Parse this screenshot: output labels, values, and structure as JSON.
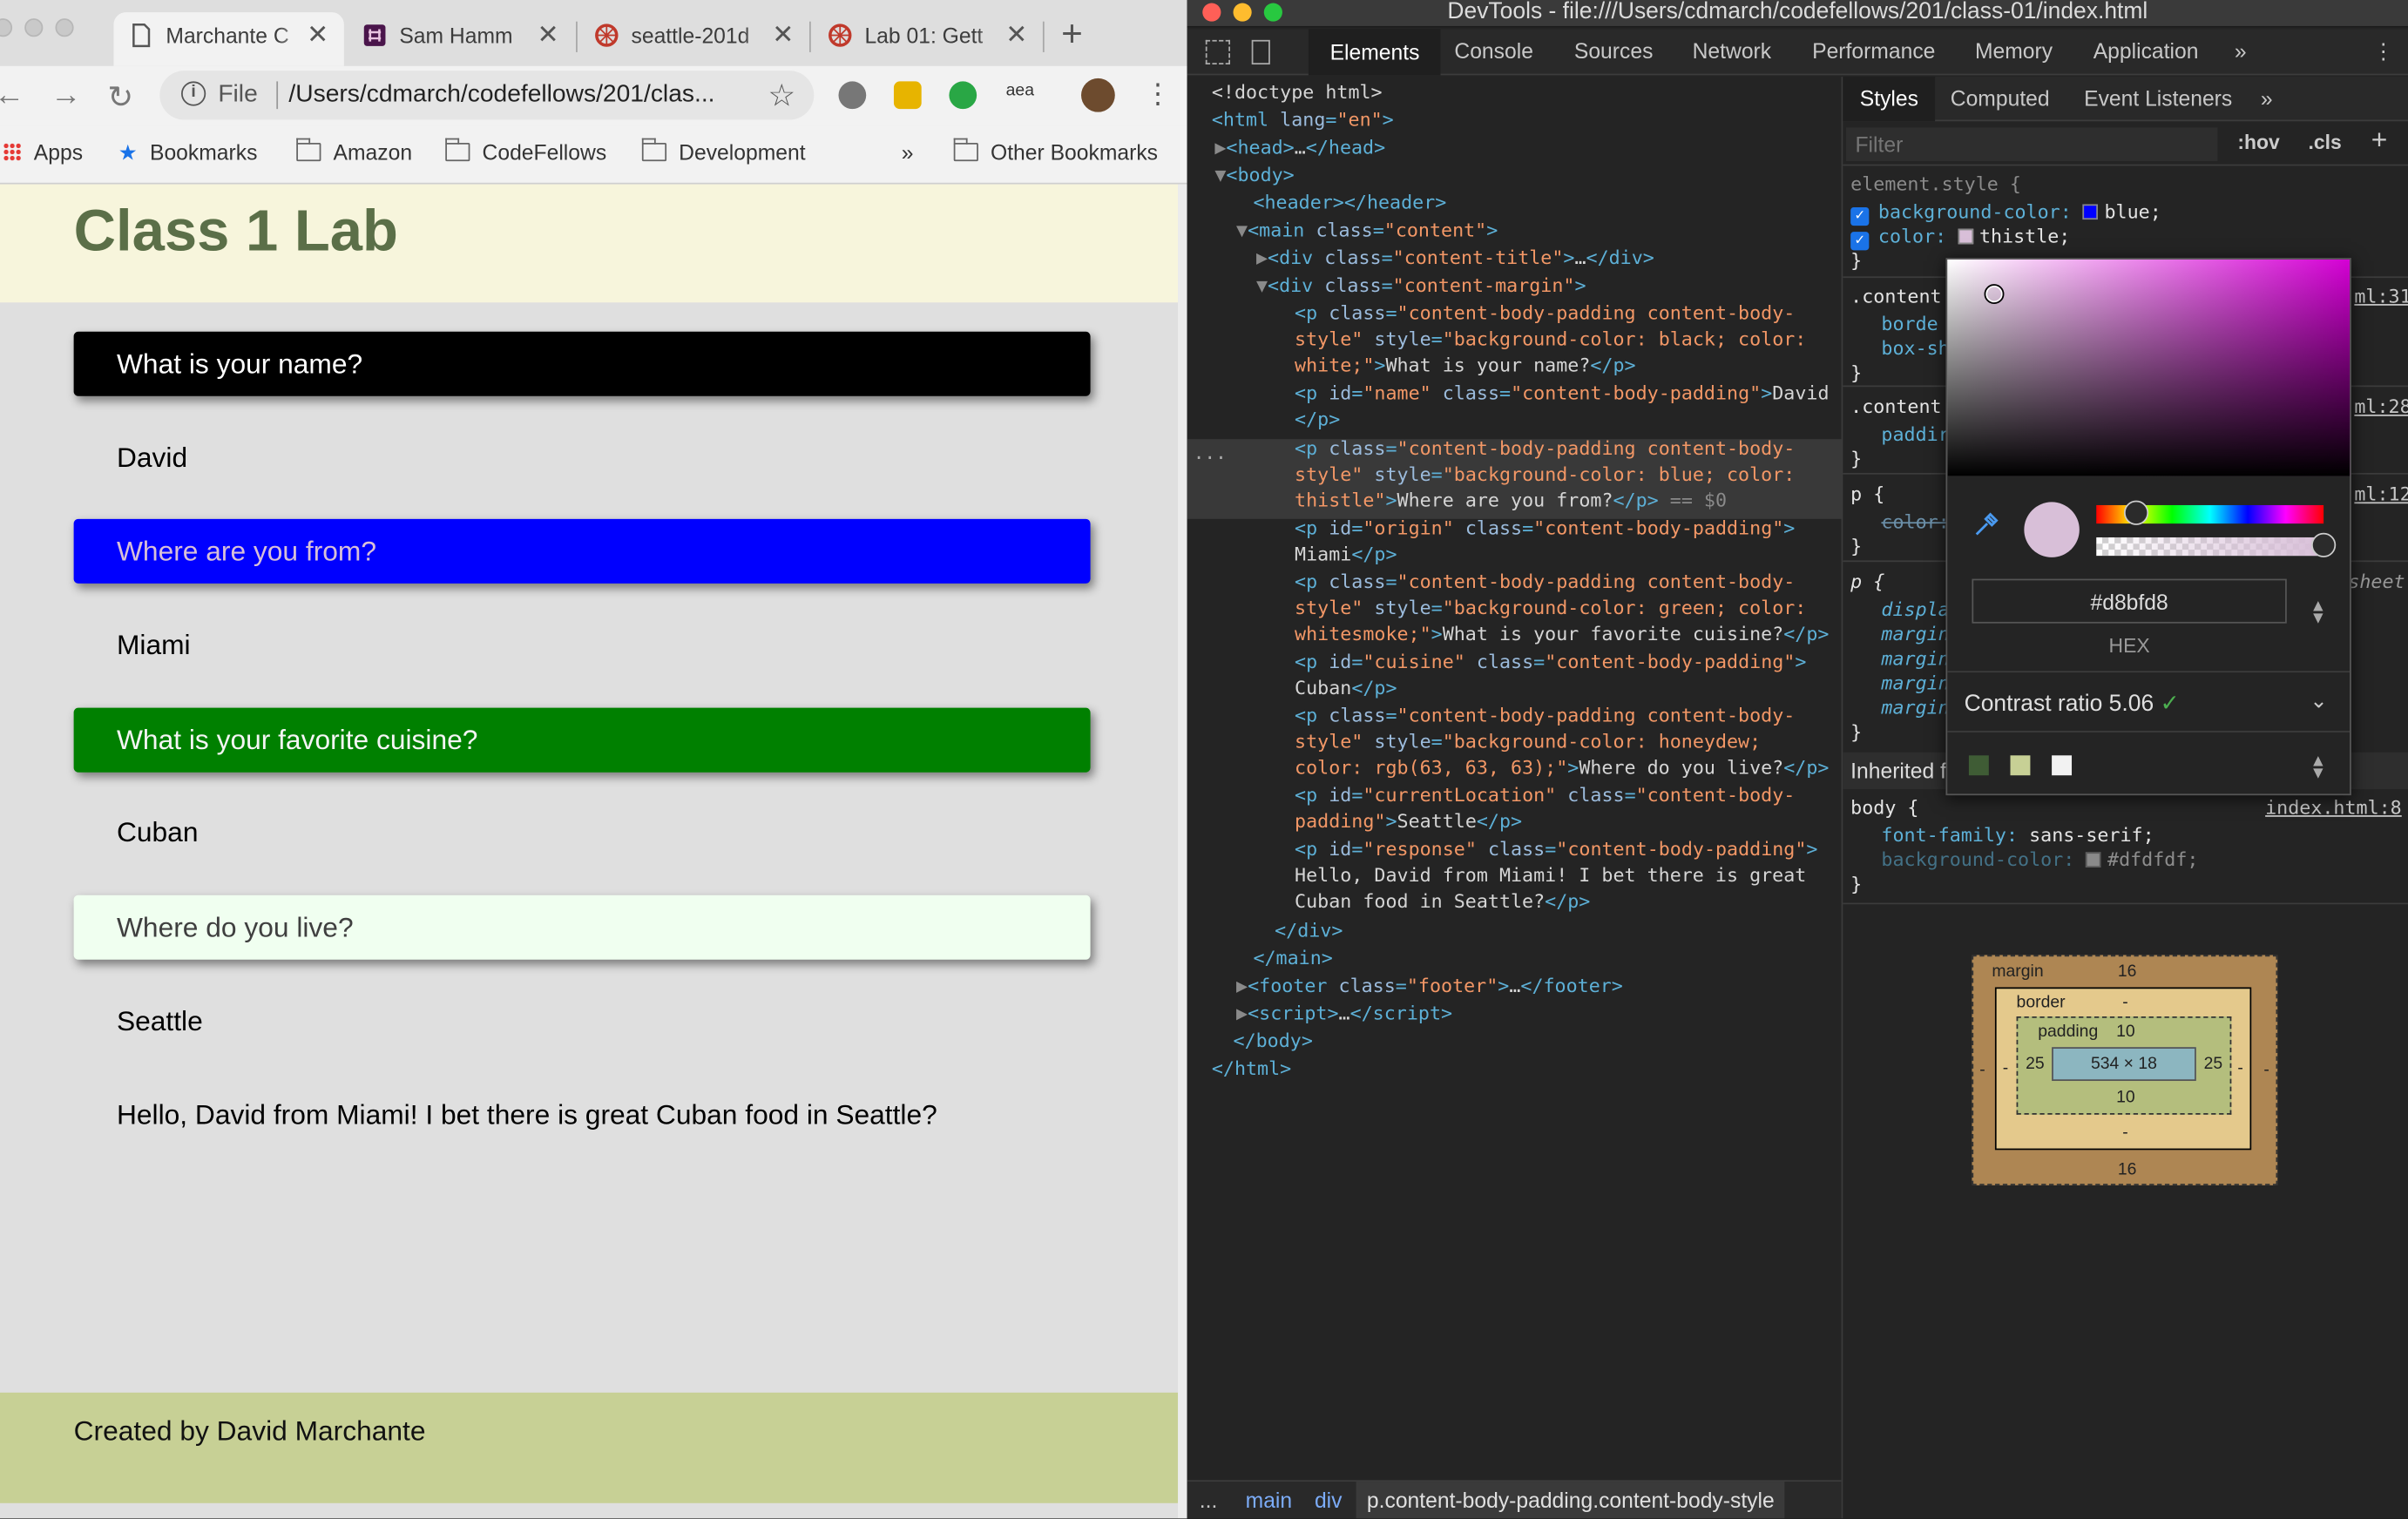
{
  "browser": {
    "tabs": [
      {
        "title": "Marchante C",
        "active": true,
        "icon": "document-icon"
      },
      {
        "title": "Sam Hamm",
        "icon": "slack-icon"
      },
      {
        "title": "seattle-201d",
        "icon": "codefellows-icon"
      },
      {
        "title": "Lab 01: Gett",
        "icon": "codefellows-icon"
      }
    ],
    "new_tab": "+",
    "omnibox": {
      "scheme": "File",
      "path": "/Users/cdmarch/codefellows/201/clas..."
    },
    "bookmarks": [
      "Apps",
      "Bookmarks",
      "Amazon",
      "CodeFellows",
      "Development"
    ],
    "bookmarks_overflow": "»",
    "other_bookmarks": "Other Bookmarks",
    "extension_text": "aea"
  },
  "page": {
    "title": "Class 1 Lab",
    "questions": [
      {
        "q": "What is your name?",
        "a": "David",
        "bg": "#000000",
        "fg": "#ffffff"
      },
      {
        "q": "Where are you from?",
        "a": "Miami",
        "bg": "#0000ff",
        "fg": "#d8bfd8"
      },
      {
        "q": "What is your favorite cuisine?",
        "a": "Cuban",
        "bg": "#008000",
        "fg": "#f5f5f5"
      },
      {
        "q": "Where do you live?",
        "a": "Seattle",
        "bg": "#f0fff0",
        "fg": "#3f3f3f"
      }
    ],
    "response": "Hello, David from Miami! I bet there is great Cuban food in Seattle?",
    "footer": "Created by David Marchante"
  },
  "devtools": {
    "title": "DevTools - file:///Users/cdmarch/codefellows/201/class-01/index.html",
    "tabs": [
      "Elements",
      "Console",
      "Sources",
      "Network",
      "Performance",
      "Memory",
      "Application"
    ],
    "tabs_overflow": "»",
    "menu_icon": "⋮",
    "styles_tabs": [
      "Styles",
      "Computed",
      "Event Listeners"
    ],
    "styles_overflow": "»",
    "filter_placeholder": "Filter",
    "hov": ":hov",
    "cls": ".cls",
    "add": "+",
    "element_style": {
      "selector": "element.style {",
      "props": [
        {
          "name": "background-color:",
          "value": "blue;",
          "swatch": "#0000ff"
        },
        {
          "name": "color:",
          "value": "thistle;",
          "swatch": "#d8bfd8"
        }
      ],
      "close": "}"
    },
    "rules_partial": [
      ".content",
      "borde",
      "box-sh",
      ".content",
      "paddir",
      "p {",
      "color:",
      "p {",
      "displa",
      "margin",
      "margin",
      "margin",
      "margin"
    ],
    "sources": [
      "ml:31",
      "ml:28",
      "ml:12",
      "sheet"
    ],
    "inherited": "Inherited f",
    "body_rule": {
      "selector": "body {",
      "source": "index.html:8",
      "props": [
        {
          "name": "font-family:",
          "value": "sans-serif;"
        },
        {
          "name": "background-color:",
          "value": "#dfdfdf;",
          "swatch": "#dfdfdf"
        }
      ]
    },
    "picker": {
      "hex": "#d8bfd8",
      "format": "HEX",
      "contrast": "Contrast ratio 5.06",
      "contrast_check": "✓",
      "palette": [
        "#3f5c35",
        "#c7d095",
        "#f2f2f2"
      ]
    },
    "box_model": {
      "margin_label": "margin",
      "margin_top": "16",
      "margin_bottom": "16",
      "margin_left": "-",
      "margin_right": "-",
      "border_label": "border",
      "border_top": "-",
      "border_bottom": "-",
      "border_left": "-",
      "border_right": "-",
      "padding_label": "padding",
      "padding_top": "10",
      "padding_bottom": "10",
      "padding_left": "25",
      "padding_right": "25",
      "content": "534 × 18"
    },
    "breadcrumbs": [
      "...",
      "main",
      "div",
      "p.content-body-padding.content-body-style"
    ],
    "dom_selected_marker": "== $0",
    "dom_ellipsis": "..."
  }
}
